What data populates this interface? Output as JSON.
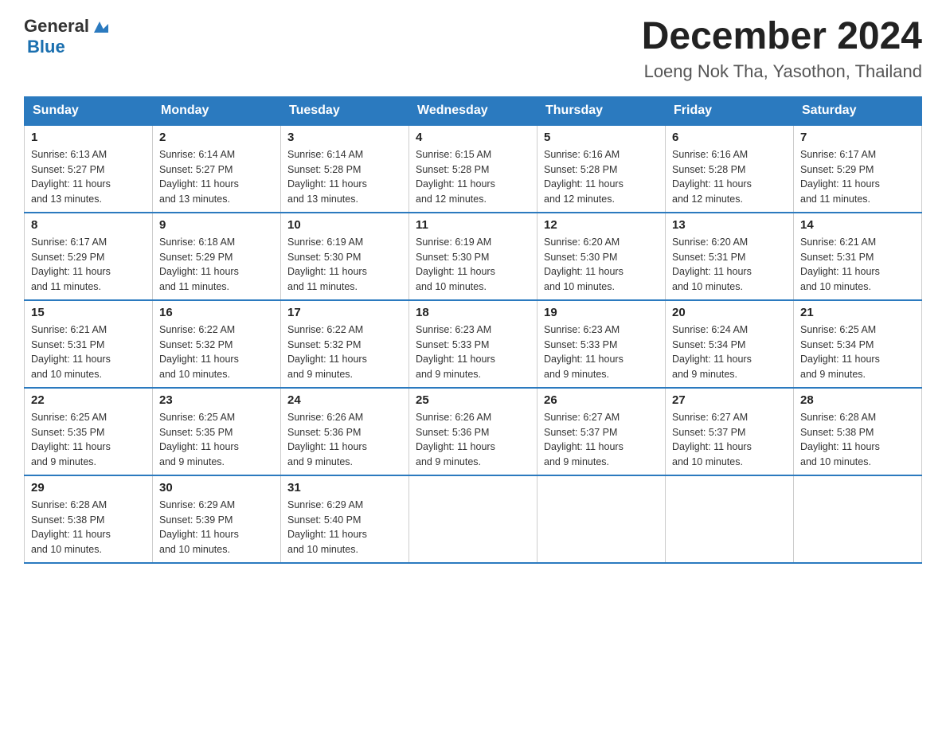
{
  "logo": {
    "general": "General",
    "blue": "Blue"
  },
  "title": "December 2024",
  "subtitle": "Loeng Nok Tha, Yasothon, Thailand",
  "weekdays": [
    "Sunday",
    "Monday",
    "Tuesday",
    "Wednesday",
    "Thursday",
    "Friday",
    "Saturday"
  ],
  "weeks": [
    [
      {
        "day": "1",
        "sunrise": "6:13 AM",
        "sunset": "5:27 PM",
        "daylight": "11 hours and 13 minutes."
      },
      {
        "day": "2",
        "sunrise": "6:14 AM",
        "sunset": "5:27 PM",
        "daylight": "11 hours and 13 minutes."
      },
      {
        "day": "3",
        "sunrise": "6:14 AM",
        "sunset": "5:28 PM",
        "daylight": "11 hours and 13 minutes."
      },
      {
        "day": "4",
        "sunrise": "6:15 AM",
        "sunset": "5:28 PM",
        "daylight": "11 hours and 12 minutes."
      },
      {
        "day": "5",
        "sunrise": "6:16 AM",
        "sunset": "5:28 PM",
        "daylight": "11 hours and 12 minutes."
      },
      {
        "day": "6",
        "sunrise": "6:16 AM",
        "sunset": "5:28 PM",
        "daylight": "11 hours and 12 minutes."
      },
      {
        "day": "7",
        "sunrise": "6:17 AM",
        "sunset": "5:29 PM",
        "daylight": "11 hours and 11 minutes."
      }
    ],
    [
      {
        "day": "8",
        "sunrise": "6:17 AM",
        "sunset": "5:29 PM",
        "daylight": "11 hours and 11 minutes."
      },
      {
        "day": "9",
        "sunrise": "6:18 AM",
        "sunset": "5:29 PM",
        "daylight": "11 hours and 11 minutes."
      },
      {
        "day": "10",
        "sunrise": "6:19 AM",
        "sunset": "5:30 PM",
        "daylight": "11 hours and 11 minutes."
      },
      {
        "day": "11",
        "sunrise": "6:19 AM",
        "sunset": "5:30 PM",
        "daylight": "11 hours and 10 minutes."
      },
      {
        "day": "12",
        "sunrise": "6:20 AM",
        "sunset": "5:30 PM",
        "daylight": "11 hours and 10 minutes."
      },
      {
        "day": "13",
        "sunrise": "6:20 AM",
        "sunset": "5:31 PM",
        "daylight": "11 hours and 10 minutes."
      },
      {
        "day": "14",
        "sunrise": "6:21 AM",
        "sunset": "5:31 PM",
        "daylight": "11 hours and 10 minutes."
      }
    ],
    [
      {
        "day": "15",
        "sunrise": "6:21 AM",
        "sunset": "5:31 PM",
        "daylight": "11 hours and 10 minutes."
      },
      {
        "day": "16",
        "sunrise": "6:22 AM",
        "sunset": "5:32 PM",
        "daylight": "11 hours and 10 minutes."
      },
      {
        "day": "17",
        "sunrise": "6:22 AM",
        "sunset": "5:32 PM",
        "daylight": "11 hours and 9 minutes."
      },
      {
        "day": "18",
        "sunrise": "6:23 AM",
        "sunset": "5:33 PM",
        "daylight": "11 hours and 9 minutes."
      },
      {
        "day": "19",
        "sunrise": "6:23 AM",
        "sunset": "5:33 PM",
        "daylight": "11 hours and 9 minutes."
      },
      {
        "day": "20",
        "sunrise": "6:24 AM",
        "sunset": "5:34 PM",
        "daylight": "11 hours and 9 minutes."
      },
      {
        "day": "21",
        "sunrise": "6:25 AM",
        "sunset": "5:34 PM",
        "daylight": "11 hours and 9 minutes."
      }
    ],
    [
      {
        "day": "22",
        "sunrise": "6:25 AM",
        "sunset": "5:35 PM",
        "daylight": "11 hours and 9 minutes."
      },
      {
        "day": "23",
        "sunrise": "6:25 AM",
        "sunset": "5:35 PM",
        "daylight": "11 hours and 9 minutes."
      },
      {
        "day": "24",
        "sunrise": "6:26 AM",
        "sunset": "5:36 PM",
        "daylight": "11 hours and 9 minutes."
      },
      {
        "day": "25",
        "sunrise": "6:26 AM",
        "sunset": "5:36 PM",
        "daylight": "11 hours and 9 minutes."
      },
      {
        "day": "26",
        "sunrise": "6:27 AM",
        "sunset": "5:37 PM",
        "daylight": "11 hours and 9 minutes."
      },
      {
        "day": "27",
        "sunrise": "6:27 AM",
        "sunset": "5:37 PM",
        "daylight": "11 hours and 10 minutes."
      },
      {
        "day": "28",
        "sunrise": "6:28 AM",
        "sunset": "5:38 PM",
        "daylight": "11 hours and 10 minutes."
      }
    ],
    [
      {
        "day": "29",
        "sunrise": "6:28 AM",
        "sunset": "5:38 PM",
        "daylight": "11 hours and 10 minutes."
      },
      {
        "day": "30",
        "sunrise": "6:29 AM",
        "sunset": "5:39 PM",
        "daylight": "11 hours and 10 minutes."
      },
      {
        "day": "31",
        "sunrise": "6:29 AM",
        "sunset": "5:40 PM",
        "daylight": "11 hours and 10 minutes."
      },
      null,
      null,
      null,
      null
    ]
  ],
  "labels": {
    "sunrise": "Sunrise:",
    "sunset": "Sunset:",
    "daylight": "Daylight:"
  }
}
